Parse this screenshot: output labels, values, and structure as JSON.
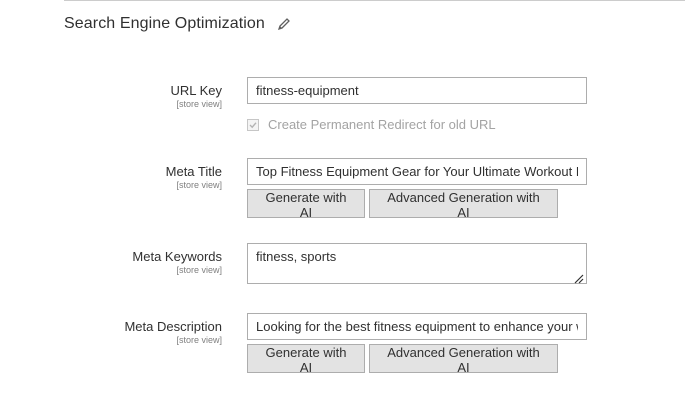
{
  "section": {
    "title": "Search Engine Optimization",
    "edit_icon": "pencil-icon"
  },
  "url_key": {
    "label": "URL Key",
    "scope": "[store view]",
    "value": "fitness-equipment",
    "redirect_label": "Create Permanent Redirect for old URL",
    "redirect_checked": true
  },
  "meta_title": {
    "label": "Meta Title",
    "scope": "[store view]",
    "value": "Top Fitness Equipment Gear for Your Ultimate Workout Rou",
    "generate_label": "Generate with AI",
    "advanced_label": "Advanced Generation with AI"
  },
  "meta_keywords": {
    "label": "Meta Keywords",
    "scope": "[store view]",
    "value": "fitness, sports"
  },
  "meta_description": {
    "label": "Meta Description",
    "scope": "[store view]",
    "value": "Looking for the best fitness equipment to enhance your wo",
    "generate_label": "Generate with AI",
    "advanced_label": "Advanced Generation with AI"
  }
}
